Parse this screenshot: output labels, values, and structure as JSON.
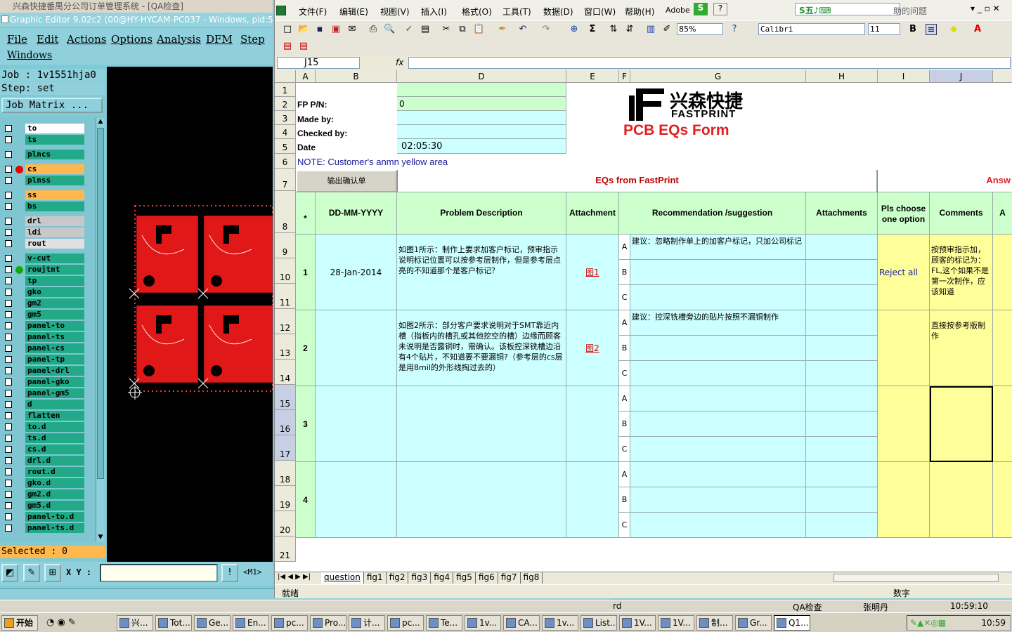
{
  "taskbar_title": "兴森快捷番禺分公司订单管理系统 - [QA检查]",
  "graphic_editor": {
    "title": "Graphic Editor 9.02c2 (00@HY-HYCAM-PC037 - Windows, pid:500)",
    "menu": [
      "File",
      "Edit",
      "Actions",
      "Options",
      "Analysis",
      "DFM",
      "Step",
      "Windows"
    ],
    "job": "Job : 1v1551hja0",
    "step": "Step: set",
    "job_matrix_label": "Job Matrix ...",
    "layers": [
      {
        "name": "to",
        "color": "#ffffff",
        "mark": ""
      },
      {
        "name": "ts",
        "color": "#22aa88",
        "mark": ""
      },
      {
        "name": "plncs",
        "color": "#22aa88",
        "mark": ""
      },
      {
        "name": "cs",
        "color": "#ffb84d",
        "mark": "red"
      },
      {
        "name": "plnss",
        "color": "#22aa88",
        "mark": ""
      },
      {
        "name": "ss",
        "color": "#ffb84d",
        "mark": ""
      },
      {
        "name": "bs",
        "color": "#22aa88",
        "mark": ""
      },
      {
        "name": "drl",
        "color": "#c8c8c8",
        "mark": ""
      },
      {
        "name": "ldi",
        "color": "#c8c8c8",
        "mark": ""
      },
      {
        "name": "rout",
        "color": "#e0e0e0",
        "mark": ""
      },
      {
        "name": "v-cut",
        "color": "#22aa88",
        "mark": ""
      },
      {
        "name": "roujtnt",
        "color": "#22aa88",
        "mark": "green"
      },
      {
        "name": "tp",
        "color": "#22aa88",
        "mark": ""
      },
      {
        "name": "gko",
        "color": "#22aa88",
        "mark": ""
      },
      {
        "name": "gm2",
        "color": "#22aa88",
        "mark": ""
      },
      {
        "name": "gm5",
        "color": "#22aa88",
        "mark": ""
      },
      {
        "name": "panel-to",
        "color": "#22aa88",
        "mark": ""
      },
      {
        "name": "panel-ts",
        "color": "#22aa88",
        "mark": ""
      },
      {
        "name": "panel-cs",
        "color": "#22aa88",
        "mark": ""
      },
      {
        "name": "panel-tp",
        "color": "#22aa88",
        "mark": ""
      },
      {
        "name": "panel-drl",
        "color": "#22aa88",
        "mark": ""
      },
      {
        "name": "panel-gko",
        "color": "#22aa88",
        "mark": ""
      },
      {
        "name": "panel-gm5",
        "color": "#22aa88",
        "mark": ""
      },
      {
        "name": "d",
        "color": "#22aa88",
        "mark": ""
      },
      {
        "name": "flatten",
        "color": "#22aa88",
        "mark": ""
      },
      {
        "name": "to.d",
        "color": "#22aa88",
        "mark": ""
      },
      {
        "name": "ts.d",
        "color": "#22aa88",
        "mark": ""
      },
      {
        "name": "cs.d",
        "color": "#22aa88",
        "mark": ""
      },
      {
        "name": "drl.d",
        "color": "#22aa88",
        "mark": ""
      },
      {
        "name": "rout.d",
        "color": "#22aa88",
        "mark": ""
      },
      {
        "name": "gko.d",
        "color": "#22aa88",
        "mark": ""
      },
      {
        "name": "gm2.d",
        "color": "#22aa88",
        "mark": ""
      },
      {
        "name": "gm5.d",
        "color": "#22aa88",
        "mark": ""
      },
      {
        "name": "panel-to.d",
        "color": "#22aa88",
        "mark": ""
      },
      {
        "name": "panel-ts.d",
        "color": "#22aa88",
        "mark": ""
      }
    ],
    "selected": "Selected : 0",
    "xy_label": "X Y :",
    "m1_label": "<M1>"
  },
  "excel": {
    "menu": [
      "文件(F)",
      "编辑(E)",
      "视图(V)",
      "插入(I)",
      "格式(O)",
      "工具(T)",
      "数据(D)",
      "窗口(W)",
      "帮助(H)",
      "Adobe"
    ],
    "help_box": "助的问题",
    "zoom": "85%",
    "font": "Calibri",
    "font_size": "11",
    "name_box": "J15",
    "fx": "fx",
    "columns": [
      "A",
      "B",
      "D",
      "E",
      "F",
      "G",
      "H",
      "I",
      "J"
    ],
    "rows": [
      "1",
      "2",
      "3",
      "4",
      "5",
      "6",
      "7",
      "8",
      "9",
      "10",
      "11",
      "12",
      "13",
      "14",
      "15",
      "16",
      "17",
      "18",
      "19",
      "20",
      "21"
    ],
    "header": {
      "fp_pn_label": "FP P/N:",
      "fp_pn_value": "0",
      "made_by_label": "Made by:",
      "checked_by_label": "Checked by:",
      "date_label": "Date",
      "date_value": "02:05:30",
      "logo_cn": "兴森快捷",
      "logo_en": "FASTPRINT",
      "form_title": "PCB EQs Form",
      "note": "NOTE: Customer's  anmn yellow area",
      "output_btn": "输出确认单",
      "eqs_title": "EQs from FastPrint",
      "answer_title": "Answ"
    },
    "table_headers": {
      "star": "*",
      "date": "DD-MM-YYYY",
      "problem": "Problem Description",
      "attachment": "Attachment",
      "recommendation": "Recommendation /suggestion",
      "attachments": "Attachments",
      "pls_choose": "Pls choose one option",
      "comments": "Comments",
      "a_col": "A"
    },
    "options": [
      "A",
      "B",
      "C"
    ],
    "eqs": [
      {
        "no": "1",
        "date": "28-Jan-2014",
        "problem": "如图1所示：制作上要求加客户标记，预审指示说明标记位置可以按参考层制作，但是参考层点亮的不知道那个是客户标记？",
        "attachment": "图1",
        "rec_a": "建议：忽略制作单上的加客户标记，只加公司标记",
        "choice": "Reject all",
        "comment": "按预审指示加，顾客的标记为：FL,这个如果不是第一次制作，应该知道"
      },
      {
        "no": "2",
        "date": "",
        "problem": "如图2所示：部分客户要求说明对于SMT靠近内槽（指板内的槽孔或其他挖空的槽）边缘而顾客未说明是否露铜时，需确认。该板控深铣槽边沿有4个贴片，不知道要不要漏铜?（参考层的cs层是用8mil的外形线掏过去的）",
        "attachment": "图2",
        "rec_a": "建议：控深铣槽旁边的贴片按照不漏铜制作",
        "choice": "",
        "comment": "直接按参考版制作"
      },
      {
        "no": "3",
        "date": "",
        "problem": "",
        "attachment": "",
        "rec_a": "",
        "choice": "",
        "comment": ""
      },
      {
        "no": "4",
        "date": "",
        "problem": "",
        "attachment": "",
        "rec_a": "",
        "choice": "",
        "comment": ""
      }
    ],
    "sheet_tabs": [
      "question",
      "fig1",
      "fig2",
      "fig3",
      "fig4",
      "fig5",
      "fig6",
      "fig7",
      "fig8"
    ],
    "status_left": "就绪",
    "status_right": "数字"
  },
  "status_strip": {
    "rd": "rd",
    "qa": "QA检查",
    "user": "张明丹",
    "time": "10:59:10"
  },
  "taskbar": {
    "start": "开始",
    "items": [
      "兴...",
      "Tot...",
      "Ge...",
      "En...",
      "pc...",
      "Pro...",
      "计...",
      "pc...",
      "Te...",
      "1v...",
      "CA...",
      "1v...",
      "List...",
      "1V...",
      "1V...",
      "制...",
      "Gr...",
      "Q1..."
    ],
    "clock": "10:59"
  }
}
